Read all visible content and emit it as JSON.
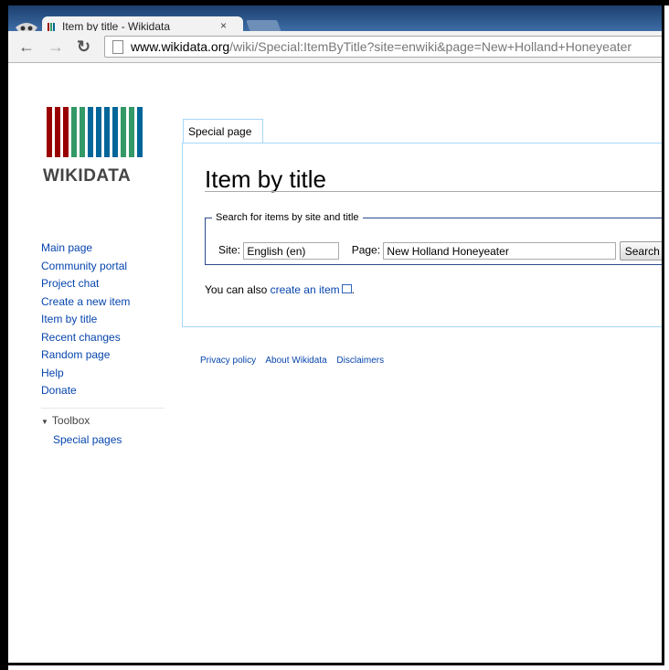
{
  "browser": {
    "tab_title": "Item by title - Wikidata",
    "tab_close": "×",
    "url_domain": "www.wikidata.org",
    "url_path": "/wiki/Special:ItemByTitle?site=enwiki&page=New+Holland+Honeyeater",
    "back_icon": "arrow-left-icon",
    "forward_icon": "arrow-right-icon",
    "reload_icon": "reload-icon"
  },
  "logo": {
    "wordmark": "WIKIDATA",
    "bar_colors": [
      "#990000",
      "#990000",
      "#990000",
      "#339966",
      "#339966",
      "#006699",
      "#006699",
      "#006699",
      "#006699",
      "#339966",
      "#339966",
      "#006699"
    ]
  },
  "sidebar": {
    "items": [
      {
        "label": "Main page"
      },
      {
        "label": "Community portal"
      },
      {
        "label": "Project chat"
      },
      {
        "label": "Create a new item"
      },
      {
        "label": "Item by title"
      },
      {
        "label": "Recent changes"
      },
      {
        "label": "Random page"
      },
      {
        "label": "Help"
      },
      {
        "label": "Donate"
      }
    ],
    "toolbox_label": "Toolbox",
    "toolbox_items": [
      {
        "label": "Special pages"
      }
    ]
  },
  "content": {
    "tab_label": "Special page",
    "title": "Item by title",
    "form": {
      "legend": "Search for items by site and title",
      "site_label": "Site:",
      "site_value": "English (en)",
      "page_label": "Page:",
      "page_value": "New Holland Honeyeater",
      "search_button": "Search"
    },
    "also_text": "You can also ",
    "also_link": "create an item",
    "also_end": "."
  },
  "footer": {
    "links": [
      "Privacy policy",
      "About Wikidata",
      "Disclaimers"
    ]
  },
  "colors": {
    "link": "#0645ad",
    "border_blue": "#a7d7f9",
    "tabstrip": "#2b5287"
  }
}
